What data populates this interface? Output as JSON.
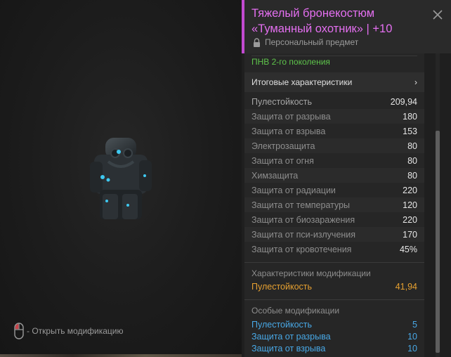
{
  "item": {
    "title": "Тяжелый бронекостюм «Туманный охотник»",
    "level": "+10",
    "personal_label": "Персональный предмет",
    "nvg": "ПНВ 2-го поколения"
  },
  "hint": {
    "label": "- Открыть модификацию"
  },
  "section_button": {
    "label": "Итоговые характеристики",
    "chevron": "›"
  },
  "stats": [
    {
      "label": "Пулестойкость",
      "value": "209,94"
    },
    {
      "label": "Защита от разрыва",
      "value": "180"
    },
    {
      "label": "Защита от взрыва",
      "value": "153"
    },
    {
      "label": "Электрозащита",
      "value": "80"
    },
    {
      "label": "Защита от огня",
      "value": "80"
    },
    {
      "label": "Химзащита",
      "value": "80"
    },
    {
      "label": "Защита от радиации",
      "value": "220"
    },
    {
      "label": "Защита от температуры",
      "value": "120"
    },
    {
      "label": "Защита от биозаражения",
      "value": "220"
    },
    {
      "label": "Защита от пси-излучения",
      "value": "170"
    },
    {
      "label": "Защита от кровотечения",
      "value": "45%"
    }
  ],
  "mod_characteristics": {
    "title": "Характеристики модификации",
    "rows": [
      {
        "label": "Пулестойкость",
        "value": "41,94"
      }
    ]
  },
  "special_mods": {
    "title": "Особые модификации",
    "rows": [
      {
        "label": "Пулестойкость",
        "value": "5"
      },
      {
        "label": "Защита от разрыва",
        "value": "10"
      },
      {
        "label": "Защита от взрыва",
        "value": "10"
      }
    ]
  },
  "colors": {
    "rarity": "#e46ff0",
    "nvg": "#5ec44b",
    "mod_value": "#e6a030",
    "special_value": "#48a8e6"
  },
  "icons": [
    "mouse-icon",
    "lock-icon",
    "close-icon",
    "chevron-right-icon"
  ]
}
